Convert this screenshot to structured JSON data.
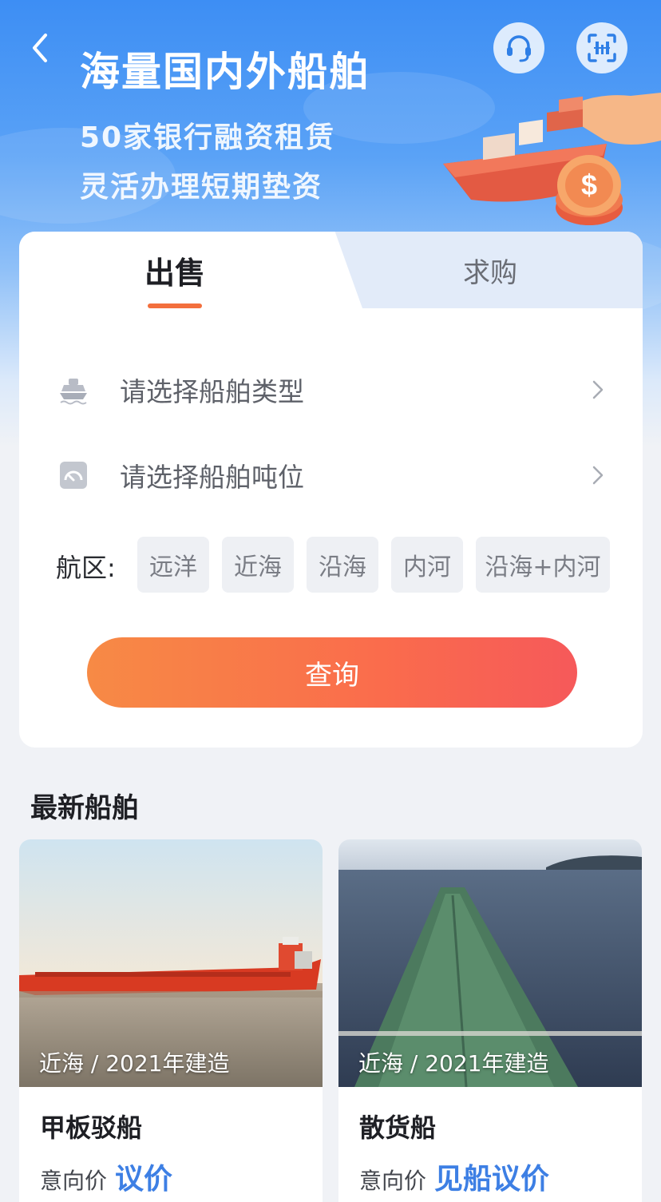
{
  "header": {
    "title": "海量国内外船舶",
    "subtitle_line1": "50家银行融资租赁",
    "subtitle_line2": "灵活办理短期垫资"
  },
  "tabs": [
    {
      "label": "出售",
      "active": true
    },
    {
      "label": "求购",
      "active": false
    }
  ],
  "filters": {
    "ship_type_placeholder": "请选择船舶类型",
    "tonnage_placeholder": "请选择船舶吨位",
    "area_label": "航区:",
    "areas": [
      "远洋",
      "近海",
      "沿海",
      "内河",
      "沿海+内河"
    ]
  },
  "query_button": "查询",
  "latest": {
    "title": "最新船舶",
    "items": [
      {
        "caption": "近海 / 2021年建造",
        "name": "甲板驳船",
        "price_label": "意向价",
        "price_value": "议价"
      },
      {
        "caption": "近海 / 2021年建造",
        "name": "散货船",
        "price_label": "意向价",
        "price_value": "见船议价"
      }
    ]
  },
  "colors": {
    "primary_blue": "#3d8ef4",
    "accent_orange": "#f36f3d",
    "price_blue": "#3d7fe4"
  }
}
